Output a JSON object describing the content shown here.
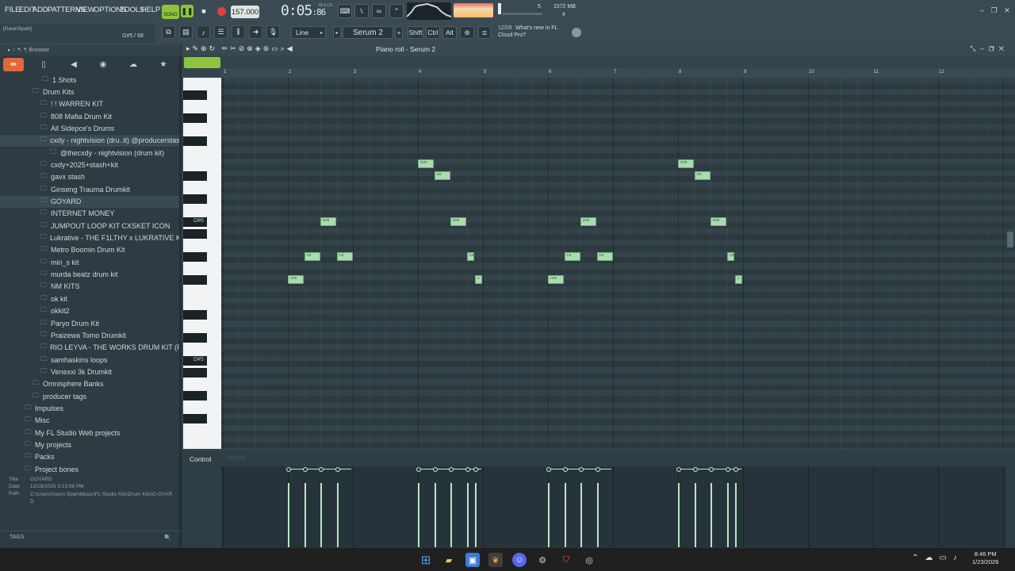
{
  "menu": [
    "FILE",
    "EDIT",
    "ADD",
    "PATTERNS",
    "VIEW",
    "OPTIONS",
    "TOOLS",
    "HELP"
  ],
  "transport": {
    "mode": "SONG",
    "tempo": "157.000",
    "time_main": "0:05",
    "time_ms": "86",
    "time_unit": "M:S:CS"
  },
  "cpu": {
    "cpu_value": "5",
    "ram": "1572 MB",
    "voices": "4"
  },
  "toolbar2": {
    "snap": "Line",
    "pattern": "Serum 2",
    "shift": "Shift",
    "ctrl": "Ctrl",
    "alt": "Alt"
  },
  "news": {
    "date": "12/09",
    "line1": "What's new in FL",
    "line2": "Cloud Pro?"
  },
  "hint": {
    "user": "[GavinSpah]",
    "note": "G#5 / 68"
  },
  "browser": {
    "header": "Browser",
    "tree": [
      {
        "label": "1 Shots",
        "indent": 36,
        "hi": false
      },
      {
        "label": "Drum Kits",
        "indent": 24,
        "hi": false
      },
      {
        "label": "! ! WARREN KIT",
        "indent": 34,
        "hi": false
      },
      {
        "label": "808 Mafia Drum Kit",
        "indent": 34,
        "hi": false
      },
      {
        "label": "All Sidepce's Drums",
        "indent": 34,
        "hi": false
      },
      {
        "label": "cxdy - nightvision (dru..it) @producerstash.com",
        "indent": 34,
        "hi": true
      },
      {
        "label": "@thecxdy - nightvision (drum kit)",
        "indent": 46,
        "hi": false
      },
      {
        "label": "cxdy+2025+stash+kit",
        "indent": 34,
        "hi": false
      },
      {
        "label": "gavx stash",
        "indent": 34,
        "hi": false
      },
      {
        "label": "Ginseng Trauma Drumkit",
        "indent": 34,
        "hi": false
      },
      {
        "label": "GOYARD",
        "indent": 34,
        "hi": true
      },
      {
        "label": "INTERNET MONEY",
        "indent": 34,
        "hi": false
      },
      {
        "label": "JUMPOUT LOOP KIT CXSKET ICON",
        "indent": 34,
        "hi": false
      },
      {
        "label": "Lukrative - THE F1LTHY x LUKRATIVE KIT",
        "indent": 34,
        "hi": false
      },
      {
        "label": "Metro Boomin Drum Kit",
        "indent": 34,
        "hi": false
      },
      {
        "label": "miri_s kit",
        "indent": 34,
        "hi": false
      },
      {
        "label": "murda beatz drum kit",
        "indent": 34,
        "hi": false
      },
      {
        "label": "NM KITS",
        "indent": 34,
        "hi": false
      },
      {
        "label": "ok kit",
        "indent": 34,
        "hi": false
      },
      {
        "label": "okkit2",
        "indent": 34,
        "hi": false
      },
      {
        "label": "Paryo Drum Kit",
        "indent": 34,
        "hi": false
      },
      {
        "label": "Praizewa Tomo Drumkit",
        "indent": 34,
        "hi": false
      },
      {
        "label": "RIO LEYVA - THE WORKS DRUM KIT (PREORDER)",
        "indent": 34,
        "hi": false
      },
      {
        "label": "samhaskins loops",
        "indent": 34,
        "hi": false
      },
      {
        "label": "Venexxi 3k Drumkit",
        "indent": 34,
        "hi": false
      },
      {
        "label": "Omnisphere Banks",
        "indent": 24,
        "hi": false
      },
      {
        "label": "producer tags",
        "indent": 24,
        "hi": false
      },
      {
        "label": "Impulses",
        "indent": 14,
        "hi": false
      },
      {
        "label": "Misc",
        "indent": 14,
        "hi": false
      },
      {
        "label": "My FL Studio Web projects",
        "indent": 14,
        "hi": false
      },
      {
        "label": "My projects",
        "indent": 14,
        "hi": false
      },
      {
        "label": "Packs",
        "indent": 14,
        "hi": false
      },
      {
        "label": "Project bones",
        "indent": 14,
        "hi": false
      }
    ],
    "info": {
      "title_label": "Title",
      "title": "GOYARD",
      "date_label": "Date",
      "date": "12/18/2025 3:13:56 PM",
      "path_label": "Path",
      "path": "C:\\Users\\Gavin Spah\\Music\\FL Studio Kits\\Drum Kits\\G-OYARD"
    },
    "tags": "TAGS"
  },
  "piano_roll": {
    "title": "Piano roll - Serum 2",
    "ruler": [
      "1",
      "2",
      "3",
      "4",
      "5",
      "6",
      "7",
      "8",
      "9",
      "10",
      "11",
      "12"
    ],
    "key_labels": [
      {
        "label": "D#6",
        "row": 12
      },
      {
        "label": "D#5",
        "row": 24
      }
    ],
    "notes": [
      {
        "label": "G#6",
        "bar": 4.0,
        "row": 7,
        "len": 0.26
      },
      {
        "label": "G6",
        "bar": 4.25,
        "row": 8,
        "len": 0.26
      },
      {
        "label": "G#6",
        "bar": 8.0,
        "row": 7,
        "len": 0.26
      },
      {
        "label": "G6",
        "bar": 8.25,
        "row": 8,
        "len": 0.26
      },
      {
        "label": "D#6",
        "bar": 2.5,
        "row": 12,
        "len": 0.26
      },
      {
        "label": "D#6",
        "bar": 4.5,
        "row": 12,
        "len": 0.26
      },
      {
        "label": "D#6",
        "bar": 6.5,
        "row": 12,
        "len": 0.26
      },
      {
        "label": "D#6",
        "bar": 8.5,
        "row": 12,
        "len": 0.26
      },
      {
        "label": "C6",
        "bar": 2.25,
        "row": 15,
        "len": 0.26
      },
      {
        "label": "C6",
        "bar": 2.75,
        "row": 15,
        "len": 0.26
      },
      {
        "label": "C6",
        "bar": 4.75,
        "row": 15,
        "len": 0.13
      },
      {
        "label": "C6",
        "bar": 6.25,
        "row": 15,
        "len": 0.26
      },
      {
        "label": "C6",
        "bar": 6.75,
        "row": 15,
        "len": 0.26
      },
      {
        "label": "C6",
        "bar": 8.75,
        "row": 15,
        "len": 0.13
      },
      {
        "label": "A#5",
        "bar": 2.0,
        "row": 17,
        "len": 0.26
      },
      {
        "label": "A",
        "bar": 4.875,
        "row": 17,
        "len": 0.13
      },
      {
        "label": "A#5",
        "bar": 6.0,
        "row": 17,
        "len": 0.26
      },
      {
        "label": "A",
        "bar": 8.875,
        "row": 17,
        "len": 0.13
      }
    ],
    "control_label": "Control",
    "control_target": "Velocity",
    "velocity_groups": [
      [
        2.0,
        2.25,
        2.5,
        2.75
      ],
      [
        4.0,
        4.25,
        4.5,
        4.75,
        4.875
      ],
      [
        6.0,
        6.25,
        6.5,
        6.75
      ],
      [
        8.0,
        8.25,
        8.5,
        8.75,
        8.875
      ]
    ]
  },
  "overlay": "hi",
  "clock": {
    "time": "8:46 PM",
    "date": "1/23/2026"
  },
  "colors": {
    "note": "#a9dcae",
    "accent": "#8dc43c",
    "record": "#e0413b"
  }
}
